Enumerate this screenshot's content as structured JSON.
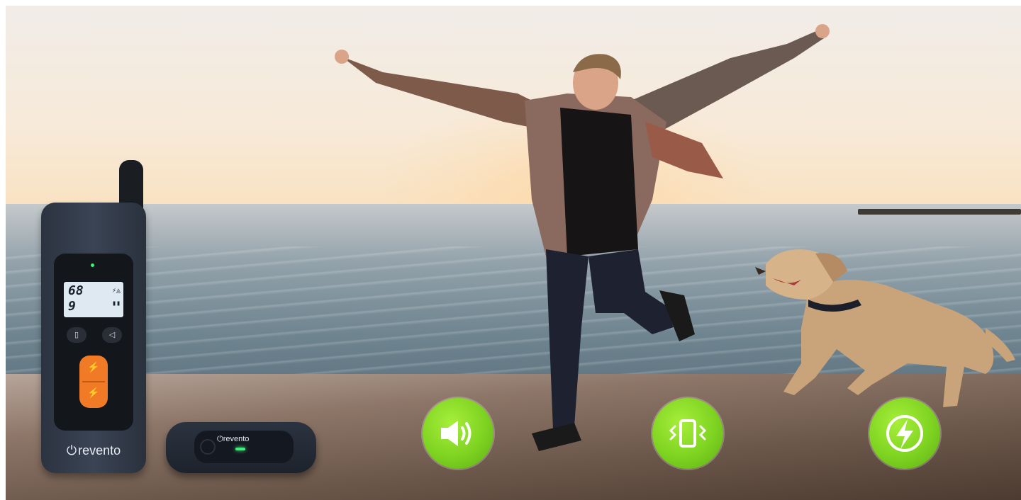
{
  "transmitter": {
    "display_top": "68",
    "display_bottom": "9",
    "brand": "revento"
  },
  "receiver": {
    "brand": "revento"
  },
  "features": [
    {
      "icon": "speaker-icon"
    },
    {
      "icon": "vibration-icon"
    },
    {
      "icon": "lightning-icon"
    }
  ],
  "colors": {
    "feature_green": "#7ed321",
    "button_orange": "#f07a26",
    "device_body": "#2f3745",
    "led_green": "#3ef07a"
  }
}
